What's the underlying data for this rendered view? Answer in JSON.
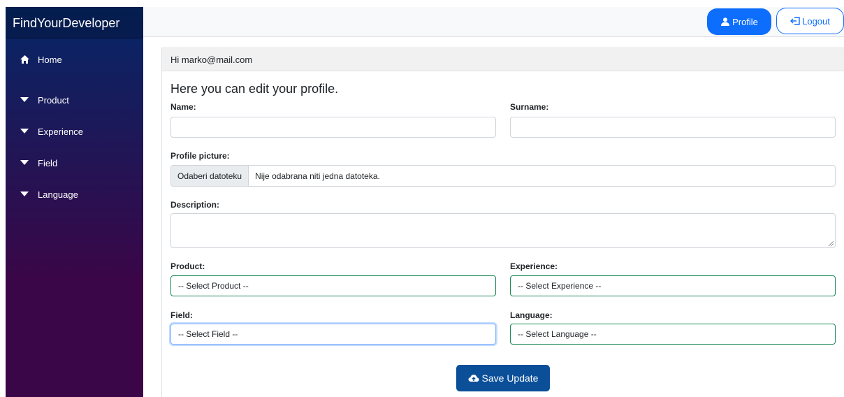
{
  "sidebar": {
    "brand": "FindYourDeveloper",
    "items": [
      {
        "label": "Home",
        "icon": "home-icon"
      },
      {
        "label": "Product",
        "icon": "caret-down-icon"
      },
      {
        "label": "Experience",
        "icon": "caret-down-icon"
      },
      {
        "label": "Field",
        "icon": "caret-down-icon"
      },
      {
        "label": "Language",
        "icon": "caret-down-icon"
      }
    ]
  },
  "topbar": {
    "profile_label": "Profile",
    "logout_label": "Logout"
  },
  "card": {
    "greeting": "Hi marko@mail.com"
  },
  "form": {
    "title": "Here you can edit your profile.",
    "name_label": "Name:",
    "name_value": "",
    "surname_label": "Surname:",
    "surname_value": "",
    "picture_label": "Profile picture:",
    "file_button": "Odaberi datoteku",
    "file_status": "Nije odabrana niti jedna datoteka.",
    "description_label": "Description:",
    "description_value": "",
    "product_label": "Product:",
    "product_selected": "-- Select Product --",
    "experience_label": "Experience:",
    "experience_selected": "-- Select Experience --",
    "field_label": "Field:",
    "field_selected": "-- Select Field --",
    "language_label": "Language:",
    "language_selected": "-- Select Language --",
    "save_label": "Save Update"
  },
  "colors": {
    "primary": "#0d6efd",
    "save_button": "#0b4f99",
    "valid_border": "#198754",
    "sidebar_top": "#052767",
    "sidebar_bottom": "#3a0647"
  }
}
